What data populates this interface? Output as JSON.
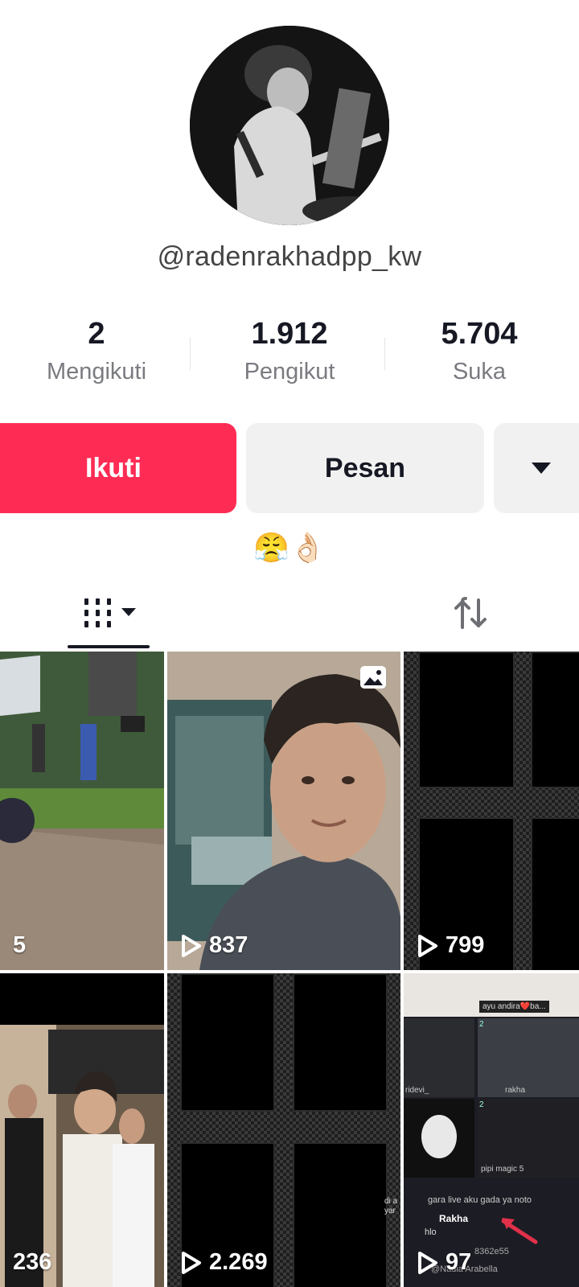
{
  "profile": {
    "username": "@radenrakhadpp_kw",
    "bio_emoji": "😤👌🏻"
  },
  "stats": [
    {
      "value": "2",
      "label": "Mengikuti"
    },
    {
      "value": "1.912",
      "label": "Pengikut"
    },
    {
      "value": "5.704",
      "label": "Suka"
    }
  ],
  "actions": {
    "follow_label": "Ikuti",
    "message_label": "Pesan"
  },
  "tabs": {
    "videos_icon": "grid-icon",
    "reposts_icon": "repost-icon"
  },
  "videos": [
    {
      "views": "5"
    },
    {
      "views": "837"
    },
    {
      "views": "799"
    },
    {
      "views": "236"
    },
    {
      "views": "2.269"
    },
    {
      "views": "97"
    }
  ],
  "thumb_text": {
    "t6_name1": "ayu andira❤️ba...",
    "t6_name2": "ridevi_",
    "t6_name3": "rakha",
    "t6_name4": "pipi magic 5",
    "t6_count1": "2",
    "t6_count2": "2",
    "t6_chat1": "gara live aku gada ya noto",
    "t6_chat2": "Rakha",
    "t6_chat3": "hlo",
    "t6_chat4": "@Nadia Arabella",
    "t6_chat5": "8362e55",
    "t5_side": "di a yar"
  },
  "colors": {
    "accent": "#fe2c55",
    "secondary_btn": "#f1f1f2"
  }
}
